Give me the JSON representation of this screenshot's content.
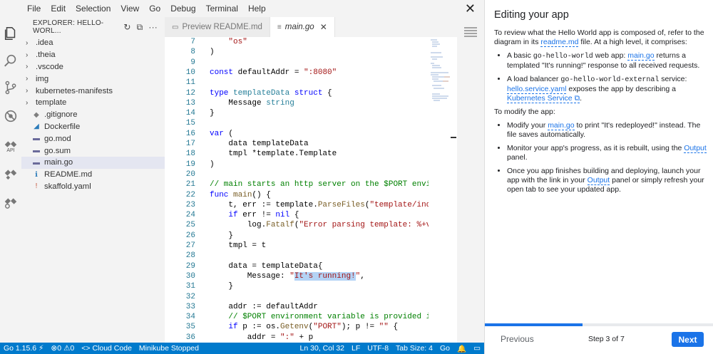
{
  "menu": [
    "File",
    "Edit",
    "Selection",
    "View",
    "Go",
    "Debug",
    "Terminal",
    "Help"
  ],
  "activity": {
    "api_label": "API"
  },
  "explorer": {
    "title": "EXPLORER: HELLO-WORL...",
    "items": [
      {
        "type": "folder",
        "label": ".idea"
      },
      {
        "type": "folder",
        "label": ".theia"
      },
      {
        "type": "folder",
        "label": ".vscode"
      },
      {
        "type": "folder",
        "label": "img"
      },
      {
        "type": "folder",
        "label": "kubernetes-manifests"
      },
      {
        "type": "folder",
        "label": "template"
      },
      {
        "type": "file",
        "label": ".gitignore",
        "icon": "gitignore-icon",
        "color": "#7f7f7f"
      },
      {
        "type": "file",
        "label": "Dockerfile",
        "icon": "docker-icon",
        "color": "#2b7bb9"
      },
      {
        "type": "file",
        "label": "go.mod",
        "icon": "go-file-icon",
        "color": "#6a6a9a"
      },
      {
        "type": "file",
        "label": "go.sum",
        "icon": "go-file-icon",
        "color": "#6a6a9a"
      },
      {
        "type": "file",
        "label": "main.go",
        "icon": "go-file-icon",
        "color": "#6a6a9a",
        "selected": true
      },
      {
        "type": "file",
        "label": "README.md",
        "icon": "markdown-icon",
        "color": "#2b7bb9"
      },
      {
        "type": "file",
        "label": "skaffold.yaml",
        "icon": "yaml-icon",
        "color": "#c5533b"
      }
    ]
  },
  "tabs": [
    {
      "label": "Preview README.md",
      "icon": "preview-icon",
      "active": false
    },
    {
      "label": "main.go",
      "icon": "go-file-icon",
      "active": true
    }
  ],
  "code": {
    "lines": [
      {
        "n": "7",
        "html": "    <span class='str'>\"os\"</span>"
      },
      {
        "n": "8",
        "html": ")"
      },
      {
        "n": "9",
        "html": ""
      },
      {
        "n": "10",
        "html": "<span class='kw'>const</span> defaultAddr = <span class='str'>\":8080\"</span>"
      },
      {
        "n": "11",
        "html": ""
      },
      {
        "n": "12",
        "html": "<span class='kw'>type</span> <span class='typ'>templateData</span> <span class='kw'>struct</span> {"
      },
      {
        "n": "13",
        "html": "    Message <span class='typ'>string</span>"
      },
      {
        "n": "14",
        "html": "}"
      },
      {
        "n": "15",
        "html": ""
      },
      {
        "n": "16",
        "html": "<span class='kw'>var</span> ("
      },
      {
        "n": "17",
        "html": "    data templateData"
      },
      {
        "n": "18",
        "html": "    tmpl *template.Template"
      },
      {
        "n": "19",
        "html": ")"
      },
      {
        "n": "20",
        "html": ""
      },
      {
        "n": "21",
        "html": "<span class='cmt'>// main starts an http server on the $PORT environment</span>"
      },
      {
        "n": "22",
        "html": "<span class='kw'>func</span> <span class='fn'>main</span>() {"
      },
      {
        "n": "23",
        "html": "    t, err := template.<span class='fn'>ParseFiles</span>(<span class='str'>\"template/index.htm</span>"
      },
      {
        "n": "24",
        "html": "    <span class='kw'>if</span> err != <span class='kw'>nil</span> {"
      },
      {
        "n": "25",
        "html": "        log.<span class='fn'>Fatalf</span>(<span class='str'>\"Error parsing template: %+v\"</span>, err)"
      },
      {
        "n": "26",
        "html": "    }"
      },
      {
        "n": "27",
        "html": "    tmpl = t"
      },
      {
        "n": "28",
        "html": ""
      },
      {
        "n": "29",
        "html": "    data = templateData{"
      },
      {
        "n": "30",
        "html": "        Message: <span class='str'>\"<span class='hl'>It's running!</span>\"</span>,"
      },
      {
        "n": "31",
        "html": "    }"
      },
      {
        "n": "32",
        "html": ""
      },
      {
        "n": "33",
        "html": "    addr := defaultAddr"
      },
      {
        "n": "34",
        "html": "    <span class='cmt'>// $PORT environment variable is provided in the K</span>"
      },
      {
        "n": "35",
        "html": "    <span class='kw'>if</span> p := os.<span class='fn'>Getenv</span>(<span class='str'>\"PORT\"</span>); p != <span class='str'>\"\"</span> {"
      },
      {
        "n": "36",
        "html": "        addr = <span class='str'>\":\"</span> + p"
      }
    ]
  },
  "status": {
    "go_version": "Go 1.15.6",
    "problems": "0",
    "warnings": "0",
    "cloud_code": "Cloud Code",
    "minikube": "Minikube Stopped",
    "position": "Ln 30, Col 32",
    "eol": "LF",
    "encoding": "UTF-8",
    "tab_size": "Tab Size: 4",
    "language": "Go"
  },
  "tutorial": {
    "title": "Editing your app",
    "intro_1": "To review what the Hello World app is composed of, refer to the diagram in its ",
    "intro_link": "readme.md",
    "intro_2": " file. At a high level, it comprises:",
    "b1_1": "A basic ",
    "b1_code": "go-hello-world",
    "b1_2": " web app: ",
    "b1_link": "main.go",
    "b1_3": " returns a templated \"It's running!\" response to all received requests.",
    "b2_1": "A load balancer ",
    "b2_code": "go-hello-world-external",
    "b2_2": " service: ",
    "b2_link": "hello.service.yaml",
    "b2_3": " exposes the app by describing a ",
    "b2_link2": "Kubernetes Service",
    "modify_heading": "To modify the app:",
    "m1_1": "Modify your ",
    "m1_link": "main.go",
    "m1_2": " to print \"It's redeployed!\" instead. The file saves automatically.",
    "m2_1": "Monitor your app's progress, as it is rebuilt, using the ",
    "m2_link": "Output",
    "m2_2": " panel.",
    "m3_1": "Once you app finishes building and deploying, launch your app with the link in your ",
    "m3_link": "Output",
    "m3_2": " panel or simply refresh your open tab to see your updated app.",
    "previous": "Previous",
    "step": "Step 3 of 7",
    "next": "Next",
    "progress": 0.428
  }
}
